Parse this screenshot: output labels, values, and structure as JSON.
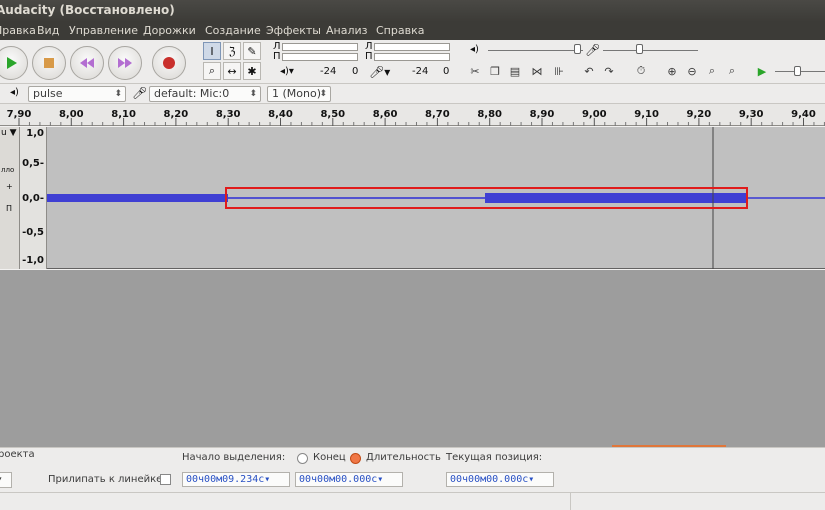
{
  "window": {
    "title": "Audacity (Восстановлено)"
  },
  "menu": [
    "Правка",
    "Вид",
    "Управление",
    "Дорожки",
    "Создание",
    "Эффекты",
    "Анализ",
    "Справка"
  ],
  "meters": {
    "channel_left": "Л",
    "channel_right": "П",
    "play_scale": [
      "-24",
      "0"
    ],
    "rec_scale": [
      "-24",
      "0"
    ]
  },
  "device": {
    "host": "pulse",
    "input_device": "default: Mic:0",
    "channels": "1 (Mono)"
  },
  "ruler": {
    "ticks": [
      "7,90",
      "8,00",
      "8,10",
      "8,20",
      "8,30",
      "8,40",
      "8,50",
      "8,60",
      "8,70",
      "8,80",
      "8,90",
      "9,00",
      "9,10",
      "9,20",
      "9,30",
      "9,40"
    ]
  },
  "track": {
    "vruler": [
      "1,0",
      "0,5-",
      "0,0-",
      "-0,5",
      "-1,0"
    ],
    "side_labels": [
      "лло",
      "+",
      "П"
    ],
    "dropdown_label": "u ▼"
  },
  "selection": {
    "project_label": "роекта",
    "snap_label": "Прилипать к линейке",
    "start_label": "Начало выделения:",
    "end_option": "Конец",
    "length_option": "Длительность",
    "position_label": "Текущая позиция:",
    "start_value": "00ч00м09.234с▾",
    "length_value": "00ч00м00.000с▾",
    "position_value": "00ч00м00.000с▾"
  },
  "colors": {
    "waveform": "#3f3fd3",
    "highlight": "#e01b1b",
    "track_bg": "#c0c0c0",
    "empty_bg": "#9d9d9d"
  }
}
